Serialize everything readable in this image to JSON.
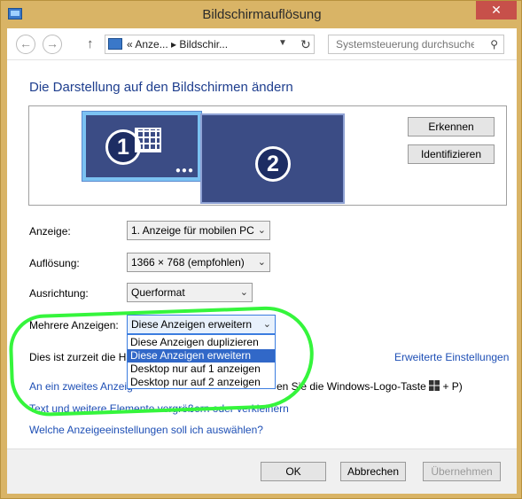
{
  "window": {
    "title": "Bildschirmauflösung",
    "close_glyph": "✕"
  },
  "addressbar": {
    "back_glyph": "←",
    "forward_glyph": "→",
    "up_glyph": "↑",
    "path": "«  Anze...  ▸  Bildschir...",
    "refresh_glyph": "↻",
    "search_placeholder": "Systemsteuerung durchsuchen"
  },
  "heading": "Die Darstellung auf den Bildschirmen ändern",
  "monitors": {
    "m1": "1",
    "m2": "2",
    "dots": "●●●"
  },
  "buttons": {
    "detect": "Erkennen",
    "identify": "Identifizieren"
  },
  "settings": {
    "display_label": "Anzeige:",
    "display_value": "1. Anzeige für mobilen PC",
    "resolution_label": "Auflösung:",
    "resolution_value": "1366 × 768 (empfohlen)",
    "orientation_label": "Ausrichtung:",
    "orientation_value": "Querformat",
    "multi_label": "Mehrere Anzeigen:",
    "multi_value": "Diese Anzeigen erweitern"
  },
  "dropdown_options": [
    "Diese Anzeigen duplizieren",
    "Diese Anzeigen erweitern",
    "Desktop nur auf 1 anzeigen",
    "Desktop nur auf 2 anzeigen"
  ],
  "dropdown_selected_index": 1,
  "info_text": "Dies ist zurzeit die Ha",
  "advanced_link": "Erweiterte Einstellungen",
  "links": {
    "second_display_a": "An ein zweites Anzeig",
    "second_display_b": "en Sie die Windows-Logo-Taste",
    "second_display_c": "+ P)",
    "text_size": "Text und weitere Elemente vergrößern oder verkleinern",
    "which_settings": "Welche Anzeigeeinstellungen soll ich auswählen?"
  },
  "footer": {
    "ok": "OK",
    "cancel": "Abbrechen",
    "apply": "Übernehmen"
  },
  "colors": {
    "accent": "#1e3e8e",
    "link": "#1e4fb5",
    "highlight": "#35f53c",
    "selection": "#3168c8"
  },
  "icons": [
    "back-arrow-icon",
    "forward-arrow-icon",
    "up-arrow-icon",
    "refresh-icon",
    "search-icon",
    "windows-logo-icon",
    "chevron-down-icon"
  ]
}
